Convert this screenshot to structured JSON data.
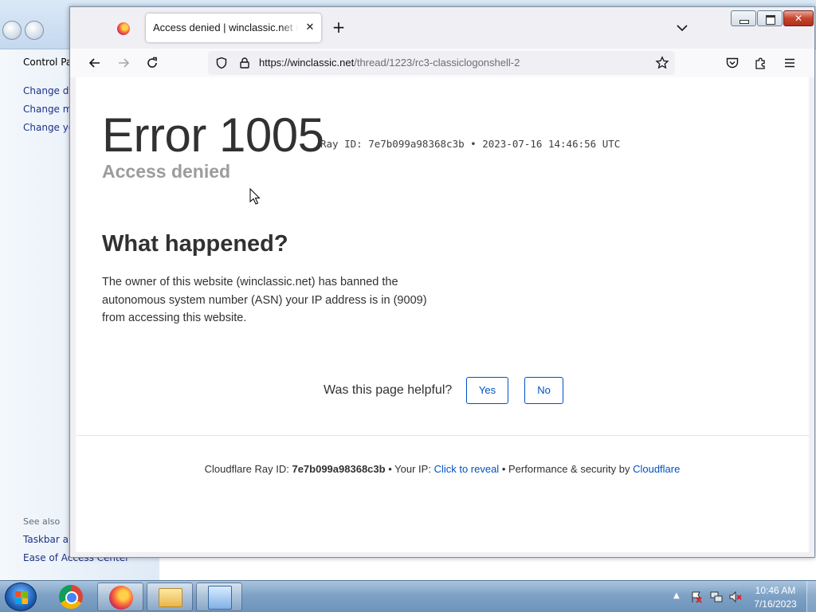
{
  "background_window": {
    "home_link": "Control Par",
    "links": [
      "Change de",
      "Change mo",
      "Change yo"
    ],
    "see_also_label": "See also",
    "see_also_links": [
      "Taskbar an",
      "Ease of Access Center"
    ]
  },
  "browser": {
    "active_tab_title": "Access denied | winclassic.net used",
    "url_host": "https://winclassic.net",
    "url_path": "/thread/1223/rc3-classiclogonshell-2"
  },
  "page": {
    "error_code": "Error 1005",
    "ray_line": "Ray ID: 7e7b099a98368c3b • 2023-07-16 14:46:56 UTC",
    "subtitle": "Access denied",
    "section_heading": "What happened?",
    "explanation": "The owner of this website (winclassic.net) has banned the autonomous system number (ASN) your IP address is in (9009) from accessing this website.",
    "helpful_question": "Was this page helpful?",
    "yes_label": "Yes",
    "no_label": "No",
    "footer": {
      "ray_label": "Cloudflare Ray ID:",
      "ray_value": "7e7b099a98368c3b",
      "sep1": "•",
      "ip_label": "Your IP:",
      "ip_link": "Click to reveal",
      "sep2": "•",
      "perf_label": "Performance & security by",
      "cloudflare_link": "Cloudflare"
    }
  },
  "taskbar": {
    "time": "10:46 AM",
    "date": "7/16/2023"
  },
  "colors": {
    "link_blue": "#0051c3",
    "heading_text": "#313131",
    "muted_text": "#9c9c9c"
  }
}
